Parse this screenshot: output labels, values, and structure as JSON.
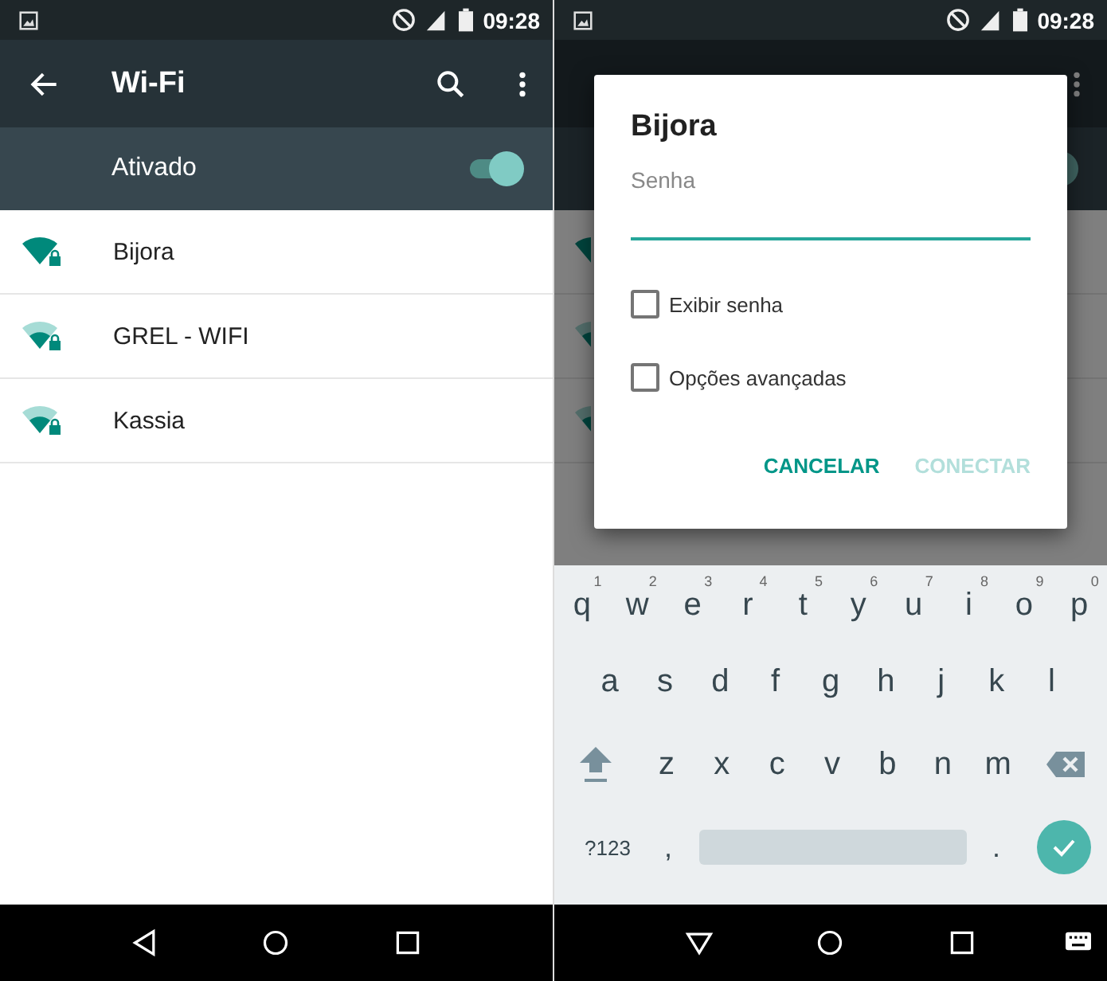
{
  "left_screen": {
    "status_bar": {
      "time": "09:28"
    },
    "app_bar": {
      "title": "Wi-Fi"
    },
    "master_switch": {
      "label": "Ativado",
      "on": true
    },
    "networks": [
      {
        "name": "Bijora",
        "kind": "strong"
      },
      {
        "name": "GREL - WIFI",
        "kind": "medium"
      },
      {
        "name": "Kassia",
        "kind": "medium"
      }
    ]
  },
  "right_screen": {
    "status_bar": {
      "time": "09:28"
    },
    "background": {
      "switch_on": true,
      "networks": [
        {
          "kind": "strong"
        },
        {
          "kind": "medium"
        },
        {
          "kind": "medium"
        }
      ]
    },
    "dialog": {
      "title": "Bijora",
      "password_field": {
        "placeholder": "Senha"
      },
      "checkboxes": [
        {
          "label": "Exibir senha",
          "checked": false
        },
        {
          "label": "Opções avançadas",
          "checked": false
        }
      ],
      "buttons": [
        {
          "label": "CANCELAR",
          "disabled": false
        },
        {
          "label": "CONECTAR",
          "disabled": true
        }
      ]
    },
    "keyboard": {
      "rows": [
        [
          {
            "key": "q",
            "hint": "1"
          },
          {
            "key": "w",
            "hint": "2"
          },
          {
            "key": "e",
            "hint": "3"
          },
          {
            "key": "r",
            "hint": "4"
          },
          {
            "key": "t",
            "hint": "5"
          },
          {
            "key": "y",
            "hint": "6"
          },
          {
            "key": "u",
            "hint": "7"
          },
          {
            "key": "i",
            "hint": "8"
          },
          {
            "key": "o",
            "hint": "9"
          },
          {
            "key": "p",
            "hint": "0"
          }
        ],
        [
          {
            "key": "a"
          },
          {
            "key": "s"
          },
          {
            "key": "d"
          },
          {
            "key": "f"
          },
          {
            "key": "g"
          },
          {
            "key": "h"
          },
          {
            "key": "j"
          },
          {
            "key": "k"
          },
          {
            "key": "l"
          }
        ],
        [
          {
            "key": "z"
          },
          {
            "key": "x"
          },
          {
            "key": "c"
          },
          {
            "key": "v"
          },
          {
            "key": "b"
          },
          {
            "key": "n"
          },
          {
            "key": "m"
          }
        ]
      ],
      "symbols_key": "?123",
      "comma_key": ",",
      "period_key": "."
    }
  }
}
